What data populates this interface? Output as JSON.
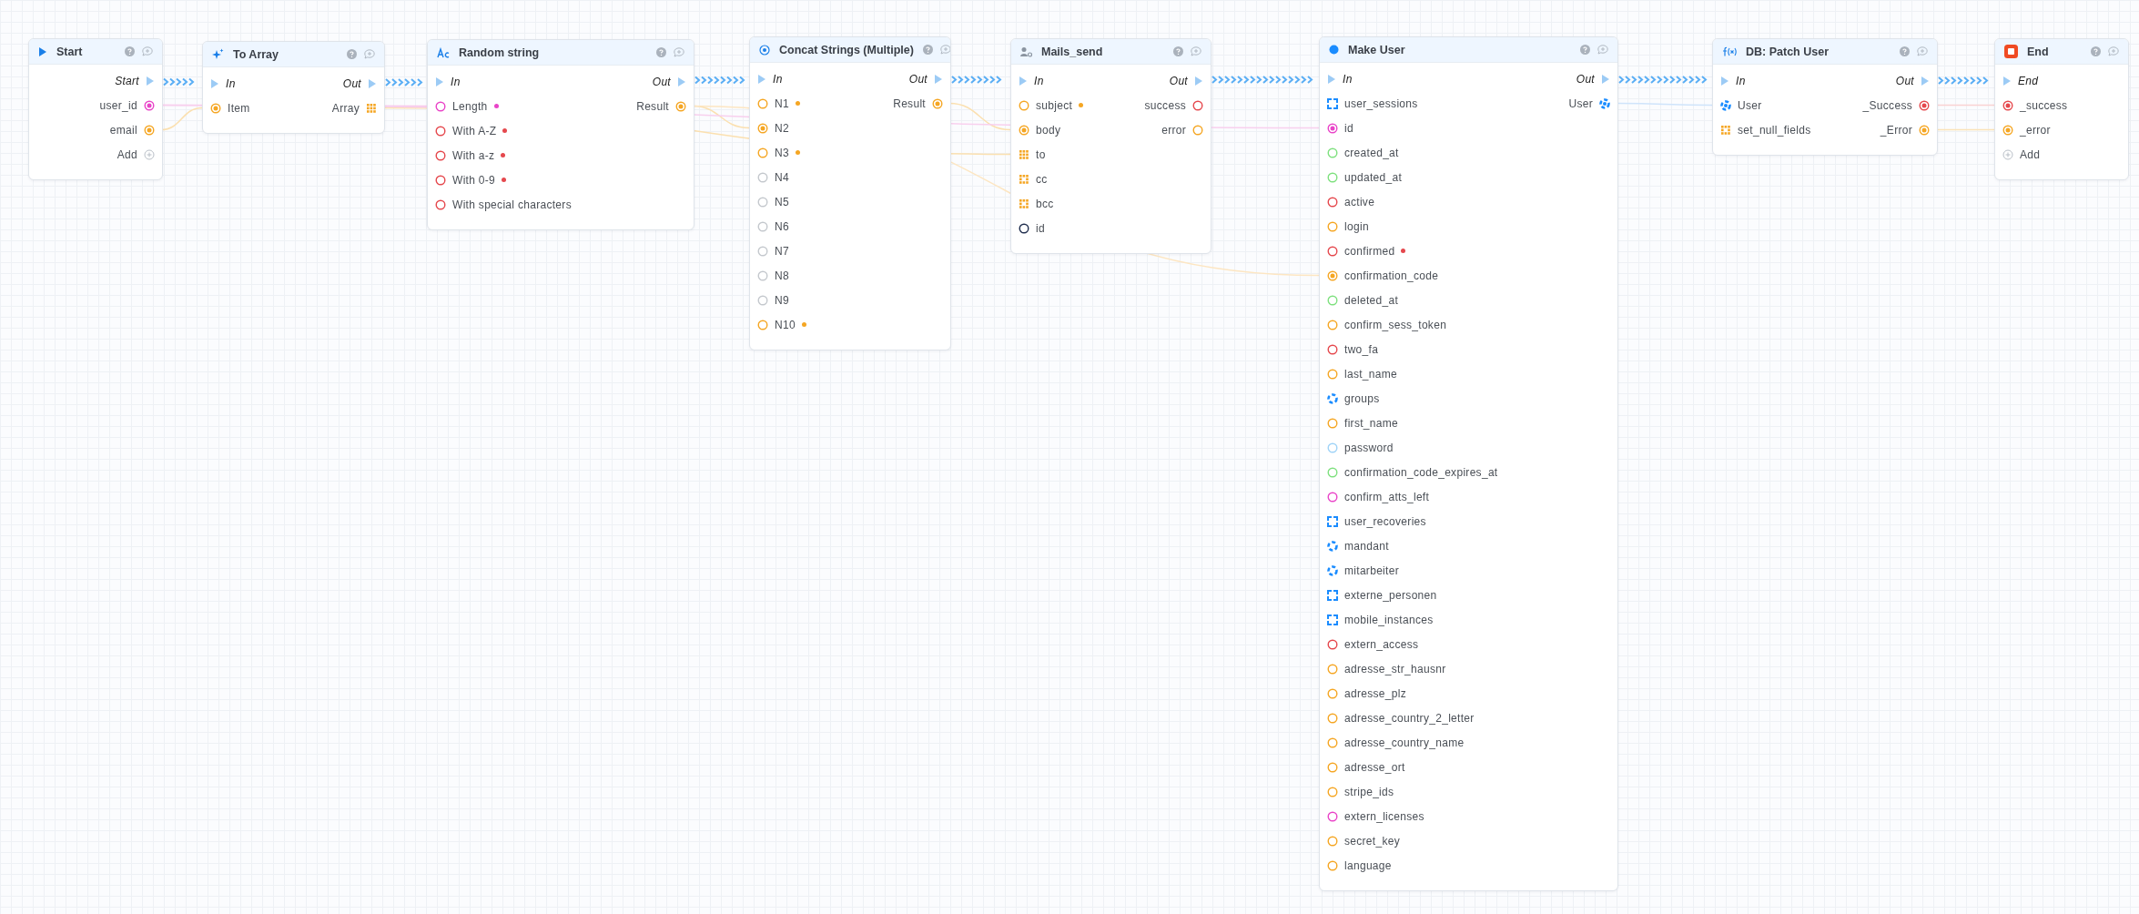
{
  "nodes": [
    {
      "title": "Start",
      "kind": "start",
      "outputs": [
        {
          "label": "Start",
          "kind": "exec",
          "required": false
        },
        {
          "label": "user_id",
          "kind": "value-set",
          "color": "#e944c8",
          "required": false
        },
        {
          "label": "email",
          "kind": "value-set",
          "color": "#f5a623",
          "required": false
        },
        {
          "label": "Add",
          "kind": "add",
          "required": false
        }
      ]
    },
    {
      "title": "To Array",
      "kind": "transform",
      "inputs": [
        {
          "label": "In",
          "kind": "exec",
          "required": false
        },
        {
          "label": "Item",
          "kind": "value-set",
          "color": "#f5a623",
          "required": false
        }
      ],
      "outputs": [
        {
          "label": "Out",
          "kind": "exec",
          "required": false
        },
        {
          "label": "Array",
          "kind": "list",
          "color": "#f5a623",
          "required": false
        }
      ]
    },
    {
      "title": "Random string",
      "kind": "text",
      "inputs": [
        {
          "label": "In",
          "kind": "exec",
          "required": false
        },
        {
          "label": "Length",
          "kind": "value",
          "color": "#e944c8",
          "required": true
        },
        {
          "label": "With A-Z",
          "kind": "value",
          "color": "#e5484d",
          "required": true
        },
        {
          "label": "With a-z",
          "kind": "value",
          "color": "#e5484d",
          "required": true
        },
        {
          "label": "With 0-9",
          "kind": "value",
          "color": "#e5484d",
          "required": true
        },
        {
          "label": "With special characters",
          "kind": "value",
          "color": "#e5484d",
          "required": false
        }
      ],
      "outputs": [
        {
          "label": "Out",
          "kind": "exec",
          "required": false
        },
        {
          "label": "Result",
          "kind": "value-set",
          "color": "#f5a623",
          "required": false
        }
      ]
    },
    {
      "title": "Concat Strings (Multiple)",
      "kind": "string",
      "inputs": [
        {
          "label": "In",
          "kind": "exec",
          "required": false
        },
        {
          "label": "N1",
          "kind": "value",
          "color": "#f5a623",
          "required": true
        },
        {
          "label": "N2",
          "kind": "value-set",
          "color": "#f5a623",
          "required": false
        },
        {
          "label": "N3",
          "kind": "value",
          "color": "#f5a623",
          "required": true
        },
        {
          "label": "N4",
          "kind": "value",
          "color": "#c4c8cd",
          "required": false
        },
        {
          "label": "N5",
          "kind": "value",
          "color": "#c4c8cd",
          "required": false
        },
        {
          "label": "N6",
          "kind": "value",
          "color": "#c4c8cd",
          "required": false
        },
        {
          "label": "N7",
          "kind": "value",
          "color": "#c4c8cd",
          "required": false
        },
        {
          "label": "N8",
          "kind": "value",
          "color": "#c4c8cd",
          "required": false
        },
        {
          "label": "N9",
          "kind": "value",
          "color": "#c4c8cd",
          "required": false
        },
        {
          "label": "N10",
          "kind": "value",
          "color": "#f5a623",
          "required": true
        }
      ],
      "outputs": [
        {
          "label": "Out",
          "kind": "exec",
          "required": false
        },
        {
          "label": "Result",
          "kind": "value-set",
          "color": "#f5a623",
          "required": false
        }
      ]
    },
    {
      "title": "Mails_send",
      "kind": "mail",
      "inputs": [
        {
          "label": "In",
          "kind": "exec",
          "required": false
        },
        {
          "label": "subject",
          "kind": "value",
          "color": "#f5a623",
          "required": true
        },
        {
          "label": "body",
          "kind": "value-set",
          "color": "#f5a623",
          "required": false
        },
        {
          "label": "to",
          "kind": "list",
          "color": "#f5a623",
          "required": false
        },
        {
          "label": "cc",
          "kind": "list-dashed",
          "color": "#f5a623",
          "required": false
        },
        {
          "label": "bcc",
          "kind": "list-dashed",
          "color": "#f5a623",
          "required": false
        },
        {
          "label": "id",
          "kind": "value",
          "color": "#1f2d4d",
          "required": false
        }
      ],
      "outputs": [
        {
          "label": "Out",
          "kind": "exec",
          "required": false
        },
        {
          "label": "success",
          "kind": "value",
          "color": "#e5484d",
          "required": false
        },
        {
          "label": "error",
          "kind": "value",
          "color": "#f5a623",
          "required": false
        }
      ]
    },
    {
      "title": "Make User",
      "kind": "model",
      "inputs": [
        {
          "label": "In",
          "kind": "exec",
          "required": false
        },
        {
          "label": "user_sessions",
          "kind": "collection",
          "color": "#1a8cff",
          "required": false
        },
        {
          "label": "id",
          "kind": "value-set",
          "color": "#e944c8",
          "required": false
        },
        {
          "label": "created_at",
          "kind": "value",
          "color": "#7ee07e",
          "required": false
        },
        {
          "label": "updated_at",
          "kind": "value",
          "color": "#7ee07e",
          "required": false
        },
        {
          "label": "active",
          "kind": "value",
          "color": "#e5484d",
          "required": false
        },
        {
          "label": "login",
          "kind": "value",
          "color": "#f5a623",
          "required": false
        },
        {
          "label": "confirmed",
          "kind": "value",
          "color": "#e5484d",
          "required": true
        },
        {
          "label": "confirmation_code",
          "kind": "value-set",
          "color": "#f5a623",
          "required": false
        },
        {
          "label": "deleted_at",
          "kind": "value",
          "color": "#7ee07e",
          "required": false
        },
        {
          "label": "confirm_sess_token",
          "kind": "value",
          "color": "#f5a623",
          "required": false
        },
        {
          "label": "two_fa",
          "kind": "value",
          "color": "#e5484d",
          "required": false
        },
        {
          "label": "last_name",
          "kind": "value",
          "color": "#f5a623",
          "required": false
        },
        {
          "label": "groups",
          "kind": "object",
          "color": "#1a8cff",
          "required": false
        },
        {
          "label": "first_name",
          "kind": "value",
          "color": "#f5a623",
          "required": false
        },
        {
          "label": "password",
          "kind": "value",
          "color": "#9fd3f7",
          "required": false
        },
        {
          "label": "confirmation_code_expires_at",
          "kind": "value",
          "color": "#7ee07e",
          "required": false
        },
        {
          "label": "confirm_atts_left",
          "kind": "value",
          "color": "#e944c8",
          "required": false
        },
        {
          "label": "user_recoveries",
          "kind": "collection",
          "color": "#1a8cff",
          "required": false
        },
        {
          "label": "mandant",
          "kind": "object",
          "color": "#1a8cff",
          "required": false
        },
        {
          "label": "mitarbeiter",
          "kind": "object",
          "color": "#1a8cff",
          "required": false
        },
        {
          "label": "externe_personen",
          "kind": "collection",
          "color": "#1a8cff",
          "required": false
        },
        {
          "label": "mobile_instances",
          "kind": "collection",
          "color": "#1a8cff",
          "required": false
        },
        {
          "label": "extern_access",
          "kind": "value",
          "color": "#e5484d",
          "required": false
        },
        {
          "label": "adresse_str_hausnr",
          "kind": "value",
          "color": "#f5a623",
          "required": false
        },
        {
          "label": "adresse_plz",
          "kind": "value",
          "color": "#f5a623",
          "required": false
        },
        {
          "label": "adresse_country_2_letter",
          "kind": "value",
          "color": "#f5a623",
          "required": false
        },
        {
          "label": "adresse_country_name",
          "kind": "value",
          "color": "#f5a623",
          "required": false
        },
        {
          "label": "adresse_ort",
          "kind": "value",
          "color": "#f5a623",
          "required": false
        },
        {
          "label": "stripe_ids",
          "kind": "value",
          "color": "#f5a623",
          "required": false
        },
        {
          "label": "extern_licenses",
          "kind": "value",
          "color": "#e944c8",
          "required": false
        },
        {
          "label": "secret_key",
          "kind": "value",
          "color": "#f5a623",
          "required": false
        },
        {
          "label": "language",
          "kind": "value",
          "color": "#f5a623",
          "required": false
        }
      ],
      "outputs": [
        {
          "label": "Out",
          "kind": "exec",
          "required": false
        },
        {
          "label": "User",
          "kind": "object-set",
          "color": "#1a8cff",
          "required": false
        }
      ]
    },
    {
      "title": "DB: Patch User",
      "kind": "function",
      "inputs": [
        {
          "label": "In",
          "kind": "exec",
          "required": false
        },
        {
          "label": "User",
          "kind": "object-set",
          "color": "#1a8cff",
          "required": false
        },
        {
          "label": "set_null_fields",
          "kind": "list-dashed",
          "color": "#f5a623",
          "required": false
        }
      ],
      "outputs": [
        {
          "label": "Out",
          "kind": "exec",
          "required": false
        },
        {
          "label": "_Success",
          "kind": "value-set",
          "color": "#e5484d",
          "required": false
        },
        {
          "label": "_Error",
          "kind": "value-set",
          "color": "#f5a623",
          "required": false
        }
      ]
    },
    {
      "title": "End",
      "kind": "end",
      "inputs": [
        {
          "label": "End",
          "kind": "exec",
          "required": false
        },
        {
          "label": "_success",
          "kind": "value-set",
          "color": "#e5484d",
          "required": false
        },
        {
          "label": "_error",
          "kind": "value-set",
          "color": "#f5a623",
          "required": false
        },
        {
          "label": "Add",
          "kind": "add",
          "required": false
        }
      ]
    }
  ]
}
